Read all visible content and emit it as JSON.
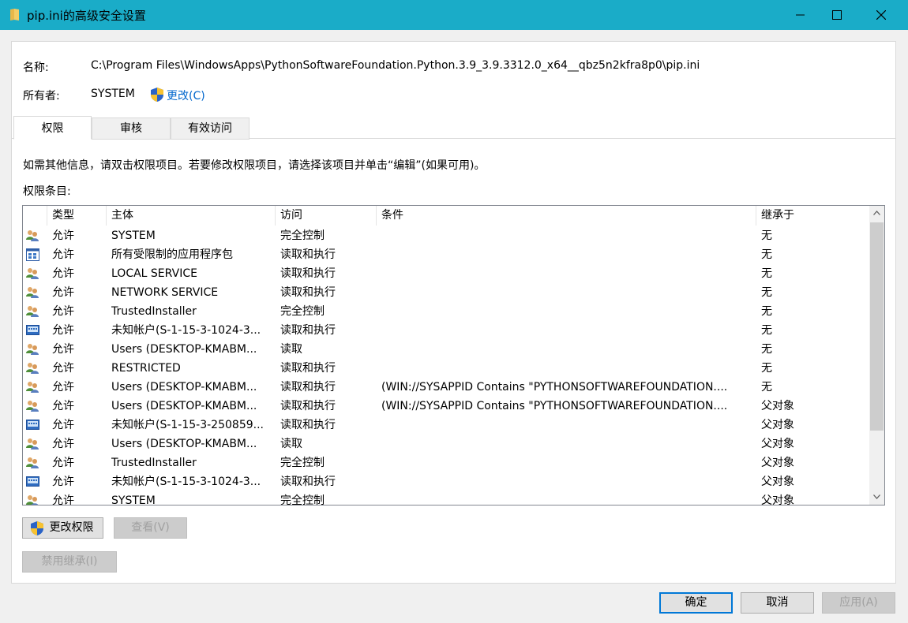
{
  "window": {
    "title": "pip.ini的高级安全设置"
  },
  "header": {
    "name_label": "名称:",
    "name_value": "C:\\Program Files\\WindowsApps\\PythonSoftwareFoundation.Python.3.9_3.9.3312.0_x64__qbz5n2kfra8p0\\pip.ini",
    "owner_label": "所有者:",
    "owner_value": "SYSTEM",
    "change_owner_link": "更改(C)"
  },
  "tabs": [
    {
      "label": "权限",
      "active": true
    },
    {
      "label": "审核",
      "active": false
    },
    {
      "label": "有效访问",
      "active": false
    }
  ],
  "info_text": "如需其他信息，请双击权限项目。若要修改权限项目，请选择该项目并单击“编辑”(如果可用)。",
  "entries_label": "权限条目:",
  "columns": {
    "type": "类型",
    "principal": "主体",
    "access": "访问",
    "condition": "条件",
    "inherited": "继承于"
  },
  "rows": [
    {
      "icon": "users-icon",
      "type": "允许",
      "principal": "SYSTEM",
      "access": "完全控制",
      "condition": "",
      "inherited": "无"
    },
    {
      "icon": "app-package-icon",
      "type": "允许",
      "principal": "所有受限制的应用程序包",
      "access": "读取和执行",
      "condition": "",
      "inherited": "无"
    },
    {
      "icon": "users-icon",
      "type": "允许",
      "principal": "LOCAL SERVICE",
      "access": "读取和执行",
      "condition": "",
      "inherited": "无"
    },
    {
      "icon": "users-icon",
      "type": "允许",
      "principal": "NETWORK SERVICE",
      "access": "读取和执行",
      "condition": "",
      "inherited": "无"
    },
    {
      "icon": "users-icon",
      "type": "允许",
      "principal": "TrustedInstaller",
      "access": "完全控制",
      "condition": "",
      "inherited": "无"
    },
    {
      "icon": "unknown-account-icon",
      "type": "允许",
      "principal": "未知帐户(S-1-15-3-1024-3...",
      "access": "读取和执行",
      "condition": "",
      "inherited": "无"
    },
    {
      "icon": "users-icon",
      "type": "允许",
      "principal": "Users (DESKTOP-KMABM...",
      "access": "读取",
      "condition": "",
      "inherited": "无"
    },
    {
      "icon": "users-icon",
      "type": "允许",
      "principal": "RESTRICTED",
      "access": "读取和执行",
      "condition": "",
      "inherited": "无"
    },
    {
      "icon": "users-icon",
      "type": "允许",
      "principal": "Users (DESKTOP-KMABM...",
      "access": "读取和执行",
      "condition": "(WIN://SYSAPPID Contains \"PYTHONSOFTWAREFOUNDATION....",
      "inherited": "无"
    },
    {
      "icon": "users-icon",
      "type": "允许",
      "principal": "Users (DESKTOP-KMABM...",
      "access": "读取和执行",
      "condition": "(WIN://SYSAPPID Contains \"PYTHONSOFTWAREFOUNDATION....",
      "inherited": "父对象"
    },
    {
      "icon": "unknown-account-icon",
      "type": "允许",
      "principal": "未知帐户(S-1-15-3-250859...",
      "access": "读取和执行",
      "condition": "",
      "inherited": "父对象"
    },
    {
      "icon": "users-icon",
      "type": "允许",
      "principal": "Users (DESKTOP-KMABM...",
      "access": "读取",
      "condition": "",
      "inherited": "父对象"
    },
    {
      "icon": "users-icon",
      "type": "允许",
      "principal": "TrustedInstaller",
      "access": "完全控制",
      "condition": "",
      "inherited": "父对象"
    },
    {
      "icon": "unknown-account-icon",
      "type": "允许",
      "principal": "未知帐户(S-1-15-3-1024-3...",
      "access": "读取和执行",
      "condition": "",
      "inherited": "父对象"
    },
    {
      "icon": "users-icon",
      "type": "允许",
      "principal": "SYSTEM",
      "access": "完全控制",
      "condition": "",
      "inherited": "父对象"
    }
  ],
  "buttons": {
    "change_permissions": "更改权限",
    "view": "查看(V)",
    "disable_inheritance": "禁用继承(I)",
    "ok": "确定",
    "cancel": "取消",
    "apply": "应用(A)"
  },
  "colors": {
    "titlebar": "#1aacc8",
    "link": "#0066cc",
    "default_button_border": "#0078d7"
  }
}
